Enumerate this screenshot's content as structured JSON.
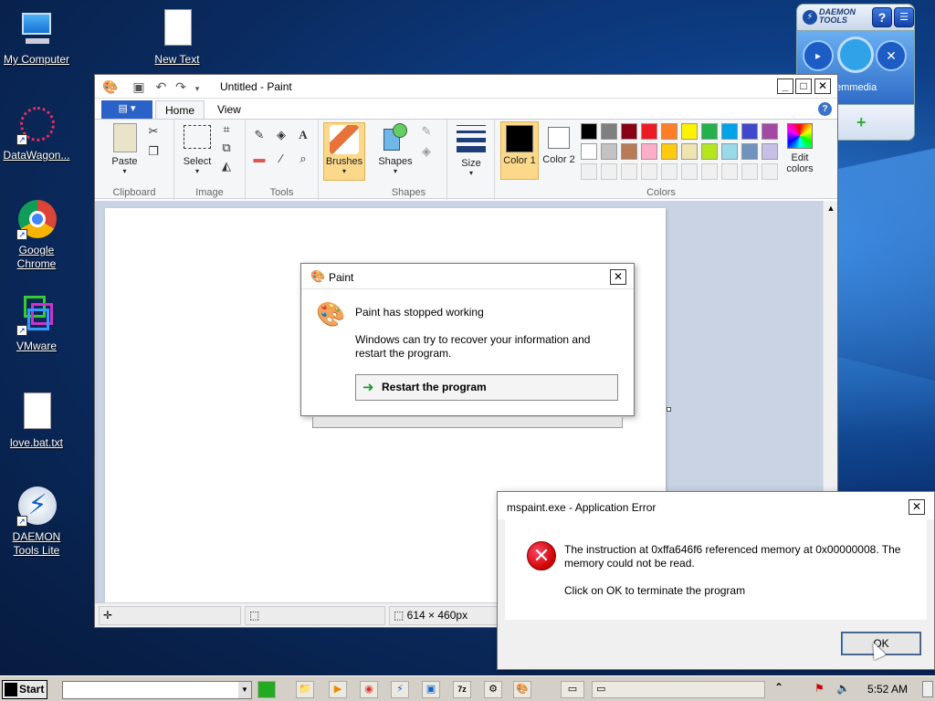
{
  "desktop": {
    "icons": [
      {
        "label": "My Computer"
      },
      {
        "label": "New Text"
      },
      {
        "label": "DataWagon..."
      },
      {
        "label": "Google Chrome"
      },
      {
        "label": "VMware"
      },
      {
        "label": "love.bat.txt"
      },
      {
        "label": "DAEMON Tools Lite"
      }
    ]
  },
  "daemon": {
    "logo": "DAEMON TOOLS",
    "caption": "emmedia"
  },
  "paint": {
    "title": "Untitled - Paint",
    "file_menu": "▤ ▾",
    "tabs": [
      "Home",
      "View"
    ],
    "help": "?",
    "groups": {
      "clipboard": "Clipboard",
      "image": "Image",
      "tools": "Tools",
      "shapes": "Shapes",
      "colors": "Colors"
    },
    "buttons": {
      "paste": "Paste",
      "select": "Select",
      "brushes": "Brushes",
      "shapes": "Shapes",
      "size": "Size",
      "color1": "Color 1",
      "color2": "Color 2",
      "edit_colors": "Edit colors"
    },
    "palette_row1": [
      "#000000",
      "#7f7f7f",
      "#880015",
      "#ed1c24",
      "#ff7f27",
      "#fff200",
      "#22b14c",
      "#00a2e8",
      "#3f48cc",
      "#a349a4"
    ],
    "palette_row2": [
      "#ffffff",
      "#c3c3c3",
      "#b97a57",
      "#ffaec9",
      "#ffc90e",
      "#efe4b0",
      "#b5e61d",
      "#99d9ea",
      "#7092be",
      "#c8bfe7"
    ],
    "status": {
      "size": "614 × 460px"
    }
  },
  "paint_crash": {
    "title": "Paint",
    "heading": "Paint has stopped working",
    "body": "Windows can try to recover your information and restart the program.",
    "restart": "Restart the program"
  },
  "app_error": {
    "title": "mspaint.exe - Application Error",
    "message": "The instruction at 0xffa646f6 referenced memory at 0x00000008. The memory could not be read.",
    "message2": "Click on OK to terminate the program",
    "ok": "OK"
  },
  "taskbar": {
    "start": "Start",
    "clock": "5:52 AM"
  }
}
